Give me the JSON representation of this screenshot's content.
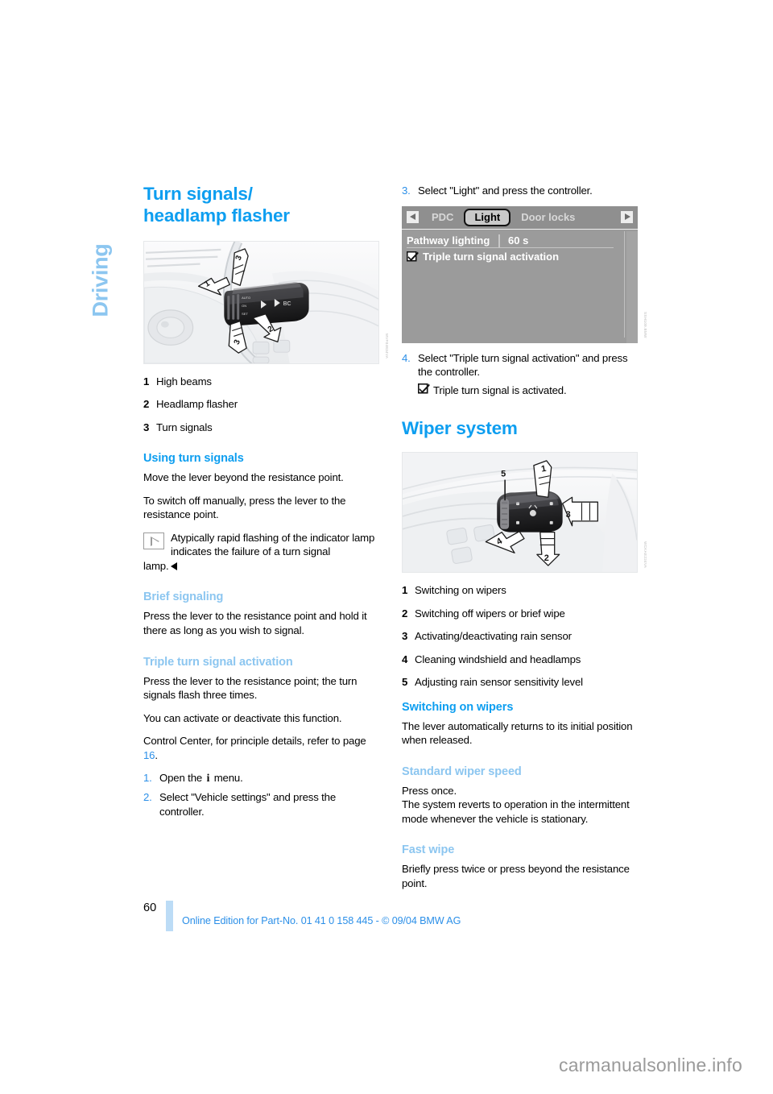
{
  "chapter": {
    "label": "Driving"
  },
  "left_column": {
    "title": "Turn signals/\nheadlamp flasher",
    "title_line1": "Turn signals/",
    "title_line2": "headlamp flasher",
    "figure": {
      "name": "turn-signal-stalk-illustration",
      "id_code": "MVF04834VA",
      "callouts": [
        "1",
        "2",
        "3"
      ]
    },
    "legend": [
      {
        "num": "1",
        "text": "High beams"
      },
      {
        "num": "2",
        "text": "Headlamp flasher"
      },
      {
        "num": "3",
        "text": "Turn signals"
      }
    ],
    "section_using": {
      "heading": "Using turn signals",
      "p1": "Move the lever beyond the resistance point.",
      "p2": "To switch off manually, press the lever to the resistance point.",
      "note": "Atypically rapid flashing of the indicator lamp indicates the failure of a turn signal",
      "note_tail": "lamp."
    },
    "section_brief": {
      "heading": "Brief signaling",
      "p1": "Press the lever to the resistance point and hold it there as long as you wish to signal."
    },
    "section_triple": {
      "heading": "Triple turn signal activation",
      "p1": "Press the lever to the resistance point; the turn signals flash three times.",
      "p2": "You can activate or deactivate this function.",
      "p3_a": "Control Center, for principle details, refer to page ",
      "p3_page": "16",
      "p3_b": ".",
      "steps": [
        {
          "num": "1.",
          "text_a": "Open the ",
          "glyph": "i",
          "text_b": " menu."
        },
        {
          "num": "2.",
          "text_a": "Select \"Vehicle settings\" and press the controller.",
          "glyph": "",
          "text_b": ""
        }
      ]
    }
  },
  "right_column": {
    "step3": {
      "num": "3.",
      "text": "Select \"Light\" and press the controller."
    },
    "idrive": {
      "name": "control-display-light-menu",
      "id_code": "SSH109.BMW",
      "left_arrow": "◀",
      "right_arrow": "▶",
      "tabs": [
        {
          "label": "PDC",
          "selected": false
        },
        {
          "label": "Light",
          "selected": true
        },
        {
          "label": "Door locks",
          "selected": false
        }
      ],
      "rows": [
        {
          "label": "Pathway lighting",
          "value": "60 s",
          "checkbox": false
        },
        {
          "label": "Triple turn signal activation",
          "value": "",
          "checkbox": true
        }
      ]
    },
    "step4": {
      "num": "4.",
      "text": "Select \"Triple turn signal activation\" and press the controller.",
      "result": "Triple turn signal is activated."
    },
    "wiper_title": "Wiper system",
    "figure": {
      "name": "wiper-stalk-illustration",
      "id_code": "WCKAE224VA",
      "callouts": [
        "1",
        "2",
        "3",
        "4",
        "5"
      ]
    },
    "legend": [
      {
        "num": "1",
        "text": "Switching on wipers"
      },
      {
        "num": "2",
        "text": "Switching off wipers or brief wipe"
      },
      {
        "num": "3",
        "text": "Activating/deactivating rain sensor"
      },
      {
        "num": "4",
        "text": "Cleaning windshield and headlamps"
      },
      {
        "num": "5",
        "text": "Adjusting rain sensor sensitivity level"
      }
    ],
    "section_switching": {
      "heading": "Switching on wipers",
      "p1": "The lever automatically returns to its initial position when released."
    },
    "section_standard": {
      "heading": "Standard wiper speed",
      "p1": "Press once.",
      "p2": "The system reverts to operation in the intermittent mode whenever the vehicle is stationary."
    },
    "section_fast": {
      "heading": "Fast wipe",
      "p1": "Briefly press twice or press beyond the resistance point."
    }
  },
  "footer": {
    "page_number": "60",
    "text": "Online Edition for Part-No. 01 41 0 158 445 - © 09/04 BMW AG"
  },
  "watermark": {
    "text": "carmanualsonline.info"
  },
  "colors": {
    "heading_blue": "#0d9ef0",
    "subheading_blue": "#8cc6f0",
    "link_blue": "#2b8fe8",
    "footer_bar": "#bcdcf6",
    "idrive_gray": "#9b9b9b"
  }
}
